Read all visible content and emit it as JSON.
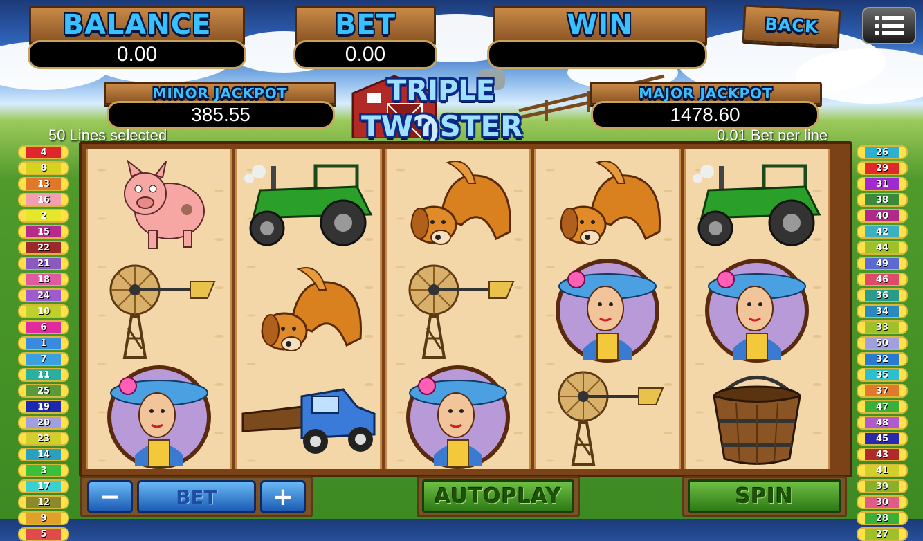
{
  "header": {
    "balance_label": "BALANCE",
    "balance_value": "0.00",
    "bet_label": "BET",
    "bet_value": "0.00",
    "win_label": "WIN",
    "win_value": "",
    "back_label": "BACK"
  },
  "jackpots": {
    "minor_label": "MINOR JACKPOT",
    "minor_value": "385.55",
    "major_label": "MAJOR JACKPOT",
    "major_value": "1478.60"
  },
  "logo": {
    "line1": "TRIPLE",
    "line2a": "TW",
    "line2b": "STER"
  },
  "info": {
    "lines_selected": "50 Lines selected",
    "bet_per_line": "0.01 Bet per line"
  },
  "lines_left": [
    "4",
    "8",
    "13",
    "16",
    "2",
    "15",
    "22",
    "21",
    "18",
    "24",
    "10",
    "6",
    "1",
    "7",
    "11",
    "25",
    "19",
    "20",
    "23",
    "14",
    "3",
    "17",
    "12",
    "9",
    "5"
  ],
  "lines_right": [
    "26",
    "29",
    "31",
    "38",
    "40",
    "42",
    "44",
    "49",
    "46",
    "36",
    "34",
    "33",
    "50",
    "32",
    "35",
    "37",
    "47",
    "48",
    "45",
    "43",
    "41",
    "39",
    "30",
    "28",
    "27"
  ],
  "reels": [
    [
      "pig",
      "windmill",
      "farm-girl"
    ],
    [
      "tractor",
      "dog",
      "truck"
    ],
    [
      "dog",
      "windmill",
      "farm-girl"
    ],
    [
      "dog",
      "farm-girl",
      "windmill"
    ],
    [
      "tractor",
      "farm-girl",
      "bucket"
    ]
  ],
  "controls": {
    "minus": "−",
    "bet_label": "BET",
    "plus": "+",
    "autoplay_label": "AUTOPLAY",
    "spin_label": "SPIN"
  },
  "colors": {
    "text_blue": "#39c1ff",
    "wood": "#8b5424",
    "grass": "#3c8a22"
  }
}
